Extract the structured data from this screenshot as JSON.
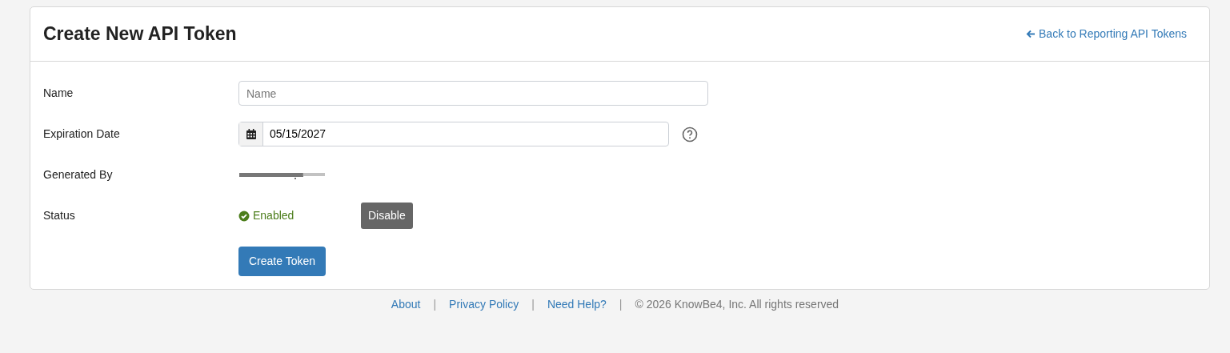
{
  "card": {
    "title": "Create New API Token",
    "back_link": "Back to Reporting API Tokens"
  },
  "form": {
    "name": {
      "label": "Name",
      "placeholder": "Name"
    },
    "expiration": {
      "label": "Expiration Date",
      "value": "05/15/2027"
    },
    "generated_by": {
      "label": "Generated By"
    },
    "status": {
      "label": "Status",
      "enabled": true,
      "text": "Enabled",
      "toggle_button": "Disable"
    },
    "submit": "Create Token"
  },
  "footer": [
    {
      "kind": "link",
      "text": "About"
    },
    {
      "kind": "separator",
      "text": "|"
    },
    {
      "kind": "link",
      "text": "Privacy Policy"
    },
    {
      "kind": "separator",
      "text": "|"
    },
    {
      "kind": "link",
      "text": "Need Help?"
    },
    {
      "kind": "separator",
      "text": "|"
    },
    {
      "kind": "text",
      "text": "© 2026 KnowBe4, Inc. All rights reserved"
    }
  ]
}
